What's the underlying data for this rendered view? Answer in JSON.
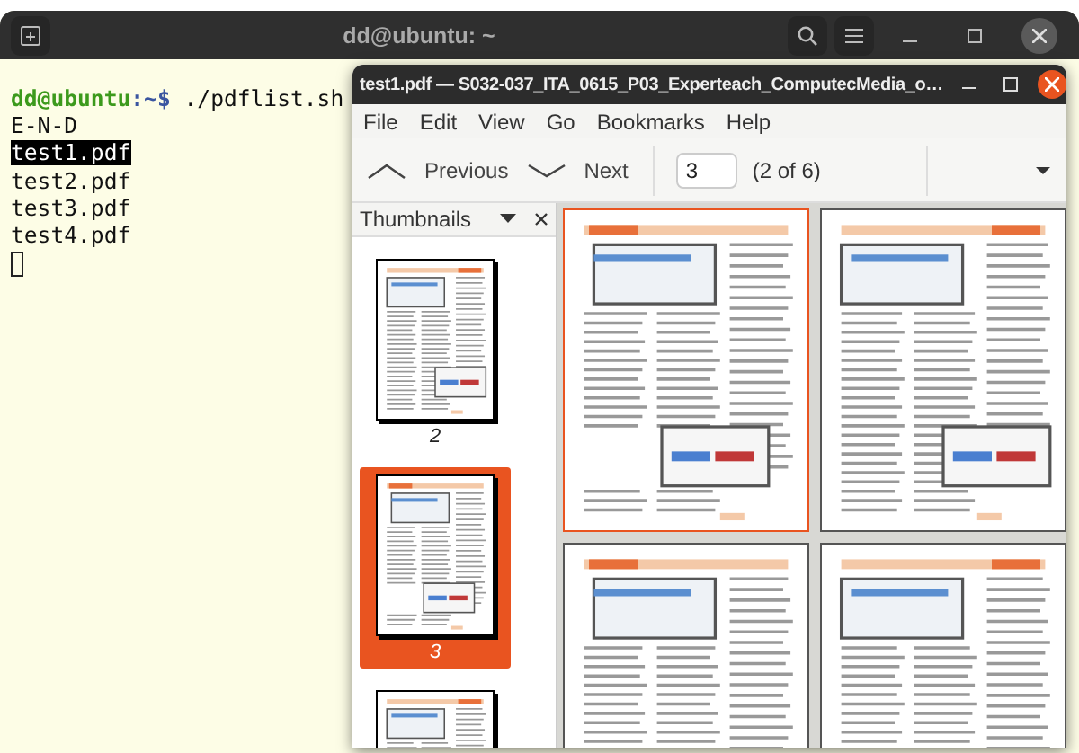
{
  "terminal": {
    "title": "dd@ubuntu: ~",
    "prompt_user": "dd@ubuntu",
    "prompt_path": ":~$",
    "command": "./pdflist.sh",
    "output": [
      {
        "text": "E-N-D",
        "selected": false
      },
      {
        "text": "test1.pdf",
        "selected": true
      },
      {
        "text": "test2.pdf",
        "selected": false
      },
      {
        "text": "test3.pdf",
        "selected": false
      },
      {
        "text": "test4.pdf",
        "selected": false
      }
    ]
  },
  "viewer": {
    "title": "test1.pdf — S032-037_ITA_0615_P03_Experteach_ComputecMedia_o…",
    "menu": [
      "File",
      "Edit",
      "View",
      "Go",
      "Bookmarks",
      "Help"
    ],
    "toolbar": {
      "previous": "Previous",
      "next": "Next",
      "page_field": "3",
      "page_count": "(2 of 6)"
    },
    "sidebar": {
      "title": "Thumbnails",
      "thumbnails": [
        {
          "label": "2",
          "selected": false
        },
        {
          "label": "3",
          "selected": true
        },
        {
          "selected": false
        }
      ]
    },
    "pages": [
      {
        "selected": true
      },
      {
        "selected": false
      },
      {
        "selected": false
      },
      {
        "selected": false
      }
    ]
  }
}
